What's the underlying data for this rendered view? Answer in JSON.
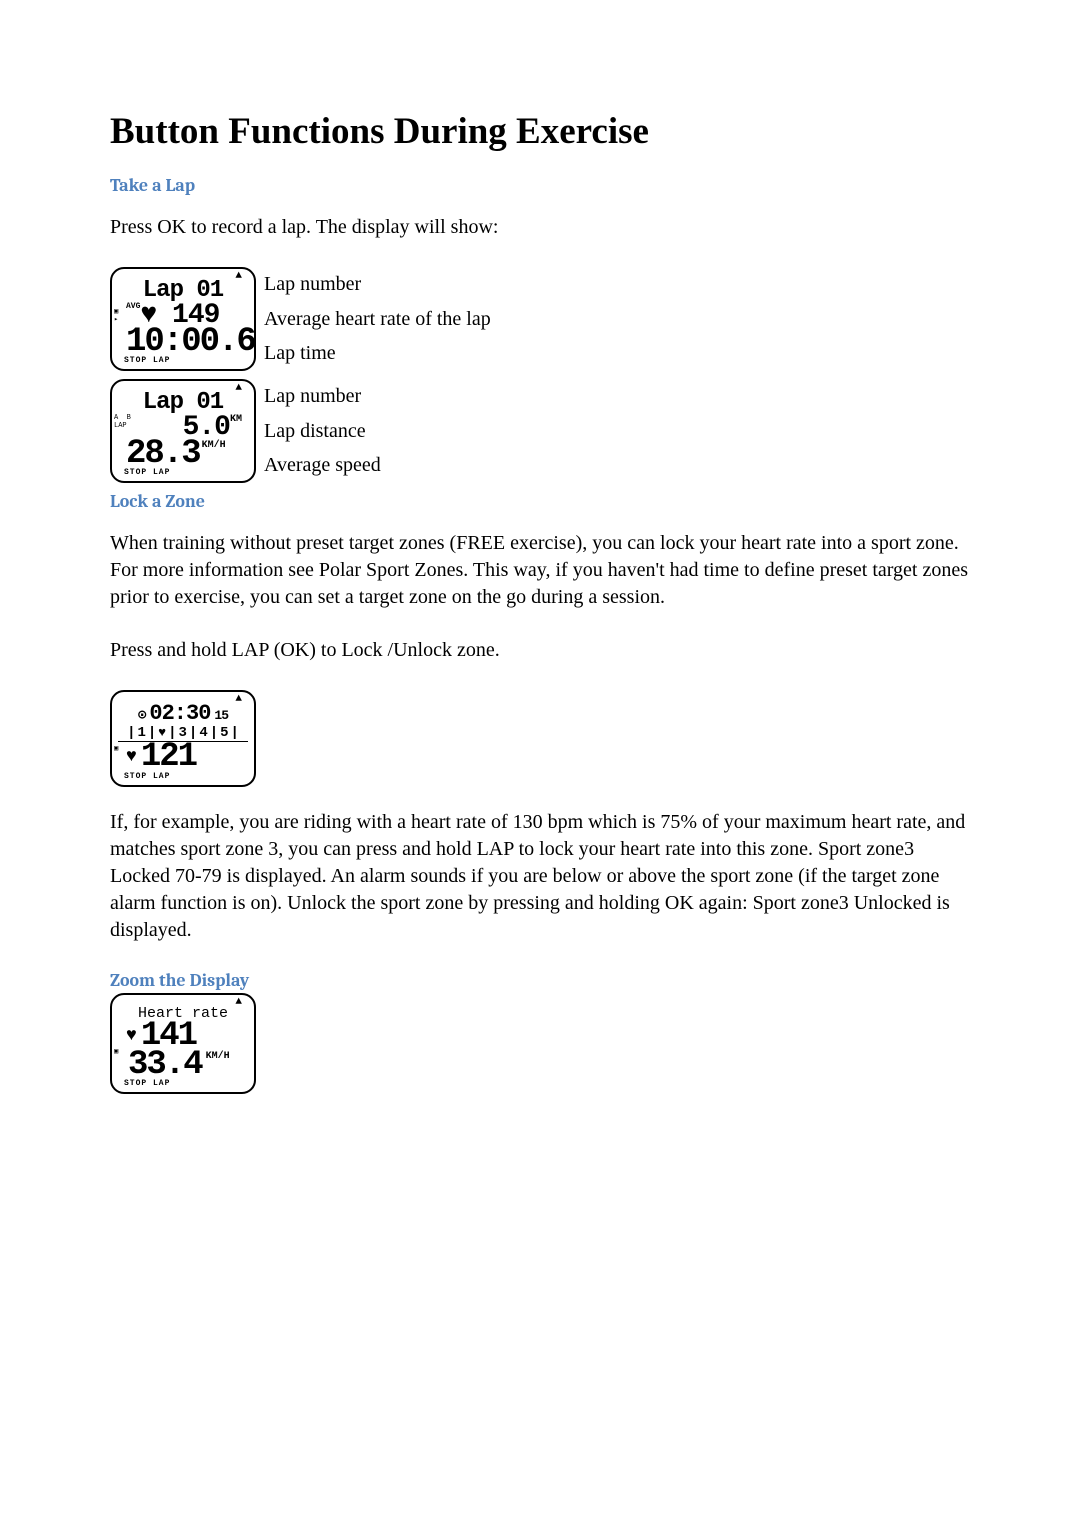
{
  "title": "Button Functions During Exercise",
  "sections": {
    "take_lap": {
      "heading": "Take a Lap",
      "intro": "Press OK to record a lap. The display will show:",
      "screen1": {
        "top": "Lap 01",
        "tiny_label": "AVG",
        "mid": "149",
        "big": "10:00.6",
        "foot": "STOP  LAP",
        "labels": {
          "a": "Lap number",
          "b": "Average heart rate of the lap",
          "c": "Lap time"
        }
      },
      "screen2": {
        "top": "Lap 01",
        "mid_val": "5.0",
        "mid_unit": "KM",
        "tiny_left": "A  B\nLAP",
        "big_val": "28.3",
        "big_unit": "KM/H",
        "foot": "STOP  LAP",
        "labels": {
          "a": "Lap number",
          "b": "Lap distance",
          "c": "Average speed"
        }
      }
    },
    "lock_zone": {
      "heading": "Lock a Zone",
      "para1": "When training without preset target zones (FREE exercise), you can lock your heart rate into a sport zone. For more information see Polar Sport Zones. This way, if you haven't had time to define preset target zones prior to exercise, you can set a target zone on the go during a session.",
      "para2": "Press and hold LAP (OK) to Lock /Unlock zone.",
      "screen": {
        "time": "02:30",
        "sec": "15",
        "bar": "1 ♥ 3 4 5",
        "big": "121",
        "foot": "STOP  LAP"
      },
      "para3": "If, for example, you are riding with a heart rate of 130 bpm which is 75% of your maximum heart rate, and matches sport zone 3, you can press and hold LAP to lock your heart rate into this zone. Sport zone3 Locked 70-79 is displayed. An alarm sounds if you are below or above the sport zone (if the target zone alarm function is on). Unlock the sport zone by pressing and holding OK again: Sport zone3 Unlocked is displayed."
    },
    "zoom": {
      "heading": "Zoom the Display",
      "screen": {
        "title": "Heart rate",
        "hr": "141",
        "speed": "33.4",
        "unit": "KM/H",
        "foot": "STOP  LAP"
      }
    }
  }
}
